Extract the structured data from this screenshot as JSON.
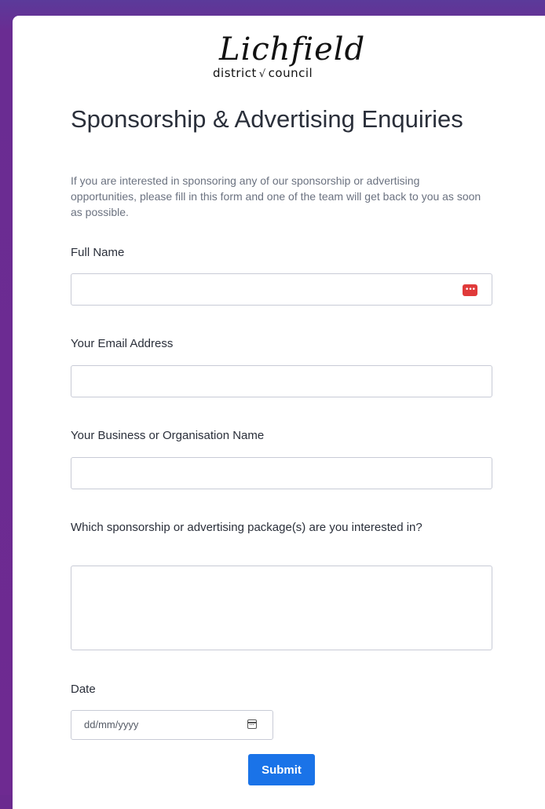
{
  "logo": {
    "script_text": "Lichfield",
    "sub_left": "district",
    "sub_right": "council"
  },
  "form": {
    "title": "Sponsorship & Advertising Enquiries",
    "description": "If you are interested in sponsoring any of our sponsorship or advertising opportunities, please fill in this form and one of the team will get back to you as soon as possible.",
    "fields": [
      {
        "label": "Full Name",
        "value": ""
      },
      {
        "label": "Your Email Address",
        "value": ""
      },
      {
        "label": "Your Business or Organisation Name",
        "value": ""
      },
      {
        "label": "Which sponsorship or advertising package(s) are you interested in?",
        "value": ""
      },
      {
        "label": "Date",
        "placeholder": "dd/mm/yyyy"
      }
    ],
    "password_manager_icon": "dots-icon",
    "calendar_icon": "calendar-icon",
    "submit_label": "Submit"
  },
  "colors": {
    "background": "#6b2a8f",
    "accent": "#1a73e8",
    "pw_icon": "#e03a3a"
  }
}
